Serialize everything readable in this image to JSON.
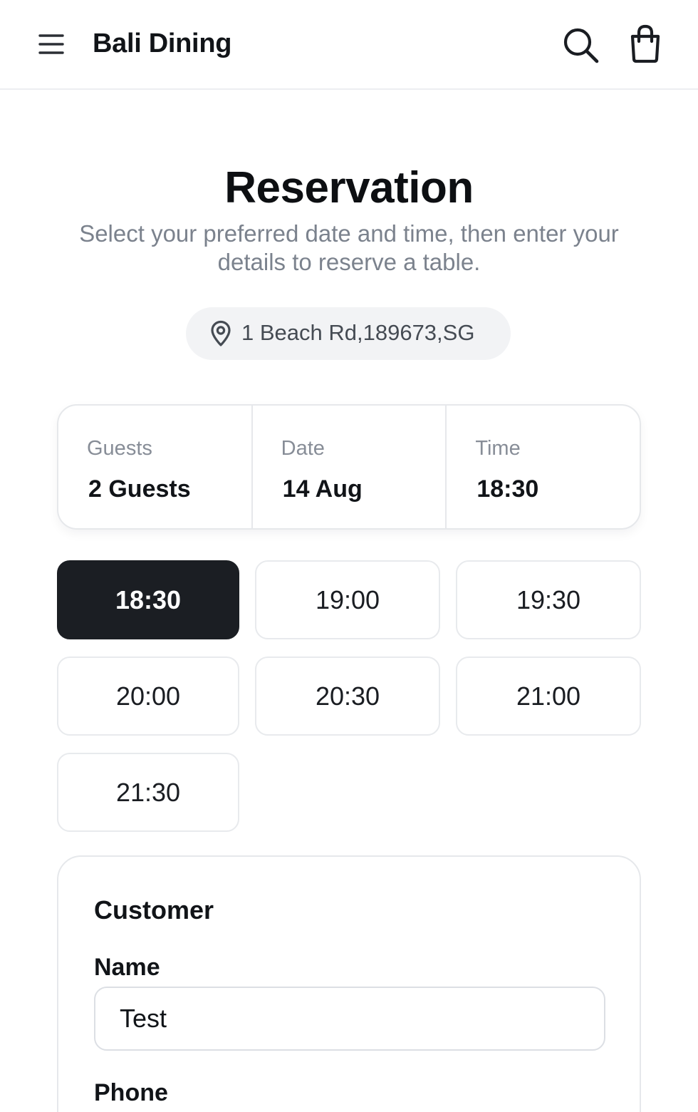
{
  "header": {
    "brand": "Bali Dining",
    "icons": [
      "menu-icon",
      "search-icon",
      "shopping-bag-icon"
    ]
  },
  "page": {
    "title": "Reservation",
    "subtitle": "Select your preferred date and time, then enter your details to reserve a table."
  },
  "location": {
    "icon": "map-pin-icon",
    "address": "1 Beach Rd,189673,SG"
  },
  "summary": [
    {
      "label": "Guests",
      "value": "2 Guests"
    },
    {
      "label": "Date",
      "value": "14 Aug"
    },
    {
      "label": "Time",
      "value": "18:30"
    }
  ],
  "time_slots": [
    {
      "time": "18:30",
      "selected": true
    },
    {
      "time": "19:00",
      "selected": false
    },
    {
      "time": "19:30",
      "selected": false
    },
    {
      "time": "20:00",
      "selected": false
    },
    {
      "time": "20:30",
      "selected": false
    },
    {
      "time": "21:00",
      "selected": false
    },
    {
      "time": "21:30",
      "selected": false
    }
  ],
  "customer": {
    "title": "Customer",
    "name_label": "Name",
    "name_value": "Test",
    "phone_label": "Phone"
  },
  "colors": {
    "selected_slot_bg": "#1b1e23",
    "muted_text": "#7b828d",
    "border": "#e6e8eb"
  }
}
